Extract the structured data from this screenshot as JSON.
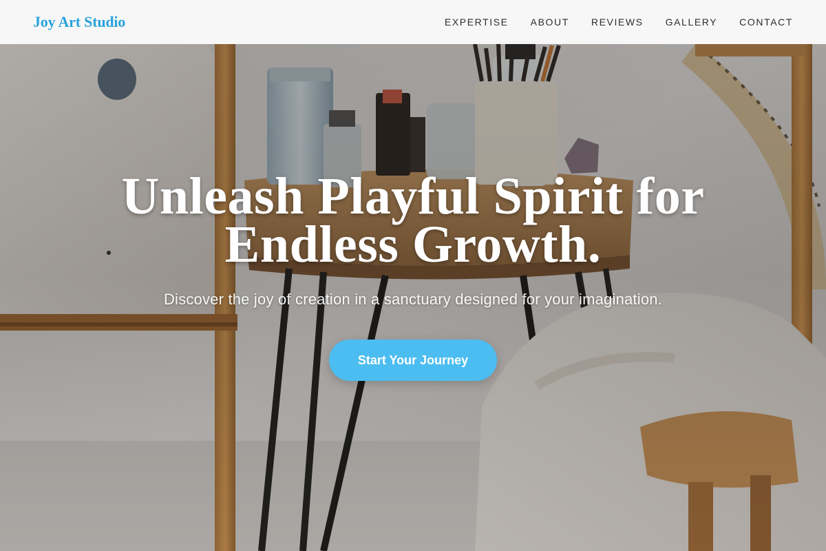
{
  "brand": {
    "name": "Joy Art Studio",
    "color": "#29a3dc"
  },
  "nav": {
    "items": [
      {
        "label": "EXPERTISE"
      },
      {
        "label": "ABOUT"
      },
      {
        "label": "REVIEWS"
      },
      {
        "label": "GALLERY"
      },
      {
        "label": "CONTACT"
      }
    ]
  },
  "hero": {
    "headline_line1": "Unleash Playful Spirit for",
    "headline_line2": "Endless Growth.",
    "subheadline": "Discover the joy of creation in a sanctuary designed for your imagination.",
    "cta_label": "Start Your Journey",
    "cta_color": "#4cbdf0"
  }
}
